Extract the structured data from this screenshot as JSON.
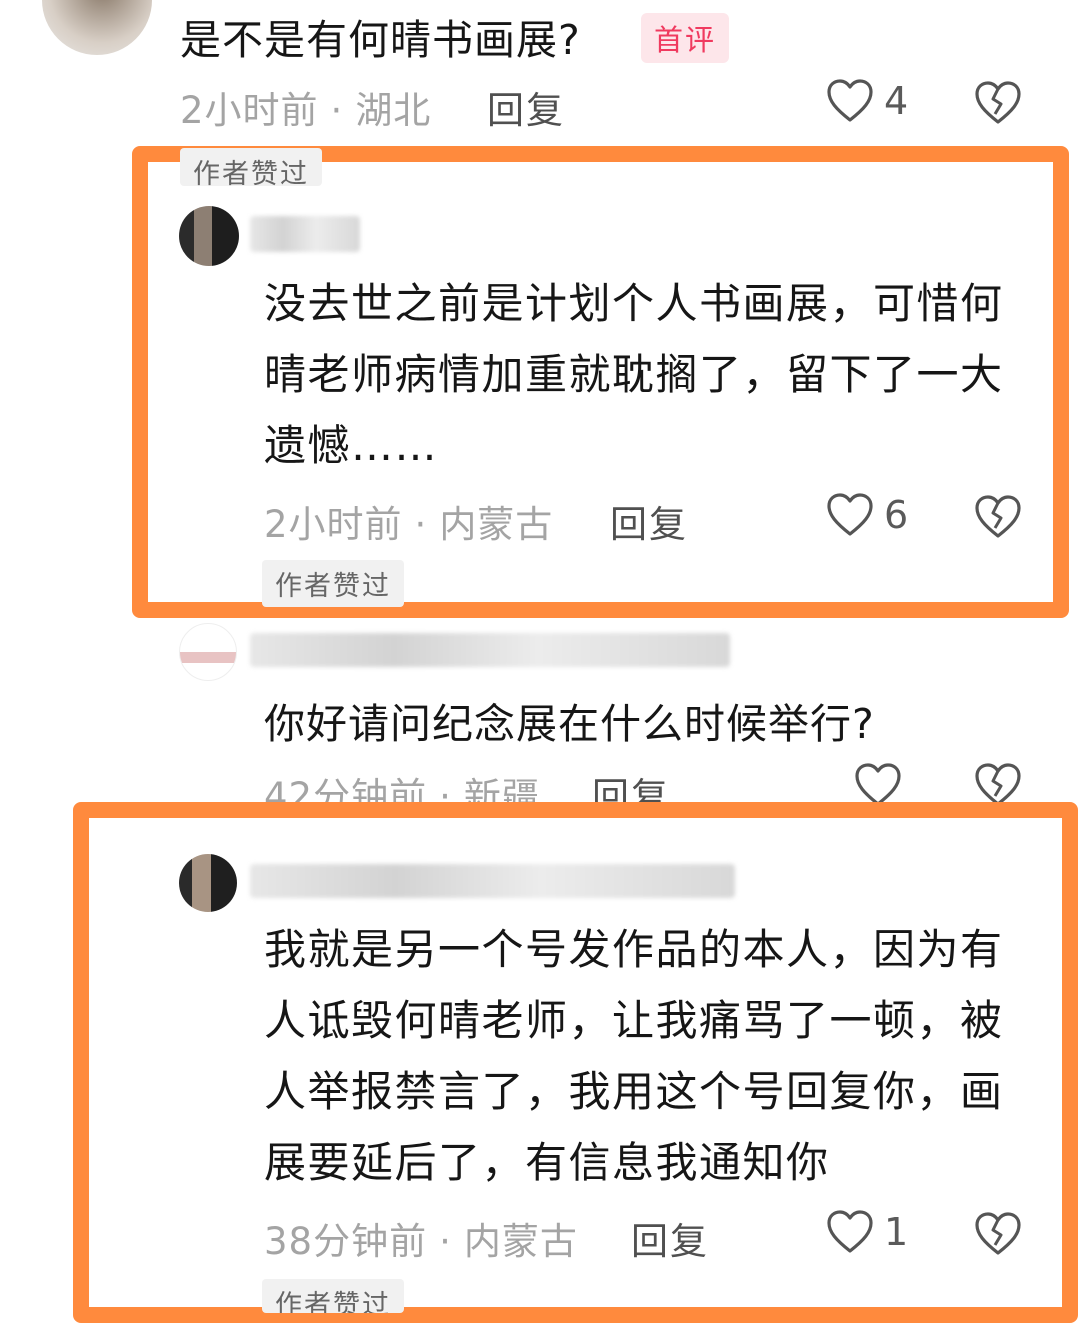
{
  "comments": [
    {
      "text": "是不是有何晴书画展?",
      "badge": "首评",
      "time": "2小时前",
      "location": "湖北",
      "reply_label": "回复",
      "likes": "4"
    },
    {
      "tag_top": "作者赞过",
      "text": "没去世之前是计划个人书画展，可惜何晴老师病情加重就耽搁了，留下了一大遗憾……",
      "time": "2小时前",
      "location": "内蒙古",
      "reply_label": "回复",
      "likes": "6",
      "tag": "作者赞过"
    },
    {
      "text": "你好请问纪念展在什么时候举行?",
      "time": "42分钟前",
      "location": "新疆",
      "reply_label": "回复",
      "likes": ""
    },
    {
      "text": "我就是另一个号发作品的本人，因为有人诋毁何晴老师，让我痛骂了一顿，被人举报禁言了，我用这个号回复你，画展要延后了，有信息我通知你",
      "time": "38分钟前",
      "location": "内蒙古",
      "reply_label": "回复",
      "likes": "1",
      "tag": "作者赞过"
    }
  ],
  "separator": "·",
  "icons": {
    "like": "heart-outline-icon",
    "dislike": "broken-heart-icon"
  },
  "colors": {
    "highlight": "#ff8a3d",
    "badge_text": "#f03a5f",
    "badge_bg": "#fde6ea",
    "meta": "#a4a4a4"
  }
}
